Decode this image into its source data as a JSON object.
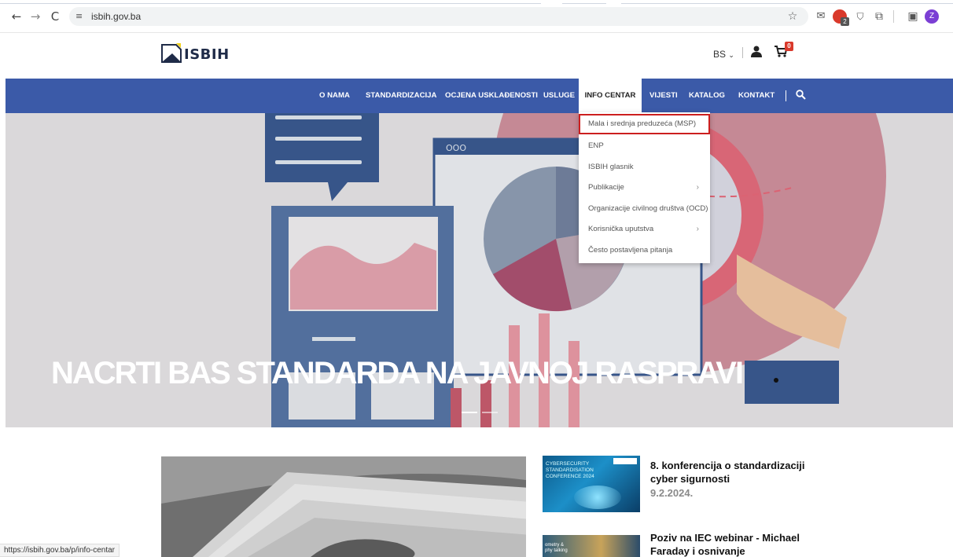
{
  "browser": {
    "url": "isbih.gov.ba",
    "back_icon": "←",
    "forward_icon": "→",
    "reload_icon": "C",
    "site_settings_icon": "≡",
    "profile_initial": "Z",
    "ext_badge": "2",
    "status_url": "https://isbih.gov.ba/p/info-centar"
  },
  "header": {
    "logo_text": "ISBIH",
    "language": "BS",
    "cart_count": "0"
  },
  "nav": {
    "items": [
      {
        "label": "O NAMA"
      },
      {
        "label": "STANDARDIZACIJA"
      },
      {
        "label": "OCJENA USKLAĐENOSTI"
      },
      {
        "label": "USLUGE"
      },
      {
        "label": "INFO CENTAR"
      },
      {
        "label": "VIJESTI"
      },
      {
        "label": "KATALOG"
      },
      {
        "label": "KONTAKT"
      }
    ],
    "active_index": 4
  },
  "dropdown": {
    "items": [
      {
        "label": "Mala i srednja preduzeća (MSP)"
      },
      {
        "label": "ENP"
      },
      {
        "label": "ISBIH glasnik"
      },
      {
        "label": "Publikacije",
        "arrow": "›"
      },
      {
        "label": "Organizacije civilnog društva (OCD)"
      },
      {
        "label": "Korisnička uputstva",
        "arrow": "›"
      },
      {
        "label": "Često postavljena pitanja"
      }
    ]
  },
  "hero": {
    "title": "NACRTI BAS STANDARDA NA JAVNOJ RASPRAVI",
    "window_dots": "OOO"
  },
  "news": {
    "thumb1_text": "CYBERSECURITY\nSTANDARDISATION\nCONFERENCE 2024",
    "thumb2_text": "ometry &\nphy talking",
    "item1_title": "8. konferencija o standardizaciji cyber sigurnosti",
    "item1_date": "9.2.2024.",
    "item2_title": "Poziv na IEC webinar - Michael Faraday i osnivanje"
  },
  "colors": {
    "nav_blue": "#3b5aa8",
    "highlight_red": "#cc1f1f",
    "logo_yellow": "#f2d21b",
    "hero_pink": "#e56b7a",
    "hero_navy": "#2e4b86"
  }
}
